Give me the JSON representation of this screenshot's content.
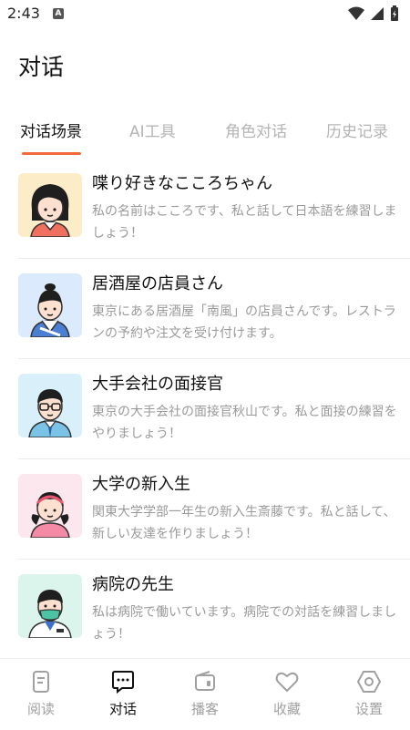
{
  "status_bar": {
    "time": "2:43",
    "notification_letter": "A"
  },
  "header": {
    "title": "对话"
  },
  "tabs": [
    {
      "label": "对话场景",
      "active": true
    },
    {
      "label": "AI工具",
      "active": false
    },
    {
      "label": "角色对话",
      "active": false
    },
    {
      "label": "历史记录",
      "active": false
    }
  ],
  "conversations": [
    {
      "title": "喋り好きなこころちゃん",
      "description": "私の名前はこころです、私と話して日本語を練習しましょう！",
      "avatar_icon": "girl-avatar-icon"
    },
    {
      "title": "居酒屋の店員さん",
      "description": "東京にある居酒屋「南風」の店員さんです。レストランの予約や注文を受け付けます。",
      "avatar_icon": "waiter-avatar-icon"
    },
    {
      "title": "大手会社の面接官",
      "description": "東京の大手会社の面接官秋山です。私と面接の練習をやりましょう！",
      "avatar_icon": "interviewer-avatar-icon"
    },
    {
      "title": "大学の新入生",
      "description": "関東大学学部一年生の新入生斎藤です。私と話して、新しい友達を作りましょう！",
      "avatar_icon": "student-avatar-icon"
    },
    {
      "title": "病院の先生",
      "description": "私は病院で働いています。病院での対話を練習しましょう！",
      "avatar_icon": "doctor-avatar-icon"
    }
  ],
  "bottom_nav": [
    {
      "label": "阅读",
      "icon": "book-icon",
      "active": false
    },
    {
      "label": "对话",
      "icon": "chat-icon",
      "active": true
    },
    {
      "label": "播客",
      "icon": "podcast-icon",
      "active": false
    },
    {
      "label": "收藏",
      "icon": "heart-icon",
      "active": false
    },
    {
      "label": "设置",
      "icon": "settings-icon",
      "active": false
    }
  ],
  "colors": {
    "accent": "#f26a3b",
    "avatar_bg_1": "#fdecc8",
    "avatar_bg_2": "#dbeafd",
    "avatar_bg_3": "#d9f0fb",
    "avatar_bg_4": "#fde7ee",
    "avatar_bg_5": "#dcf5ec"
  }
}
